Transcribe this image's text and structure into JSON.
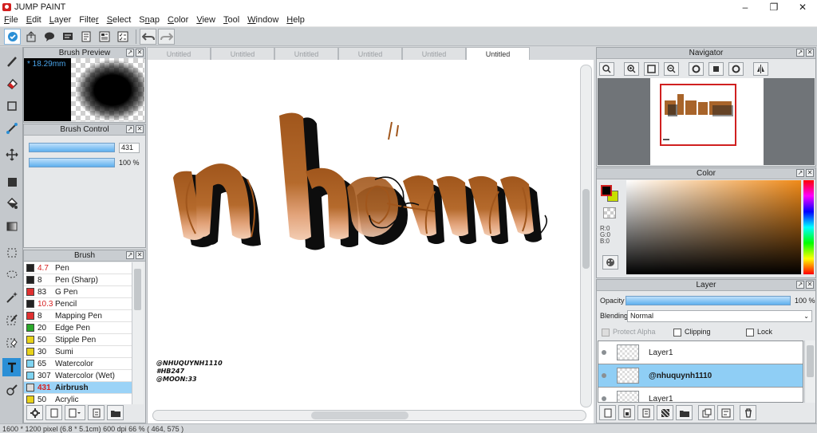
{
  "window": {
    "title": "JUMP PAINT",
    "minimize": "–",
    "maximize": "❐",
    "close": "✕"
  },
  "menu": [
    {
      "label": "File",
      "u": "F",
      "rest": "ile"
    },
    {
      "label": "Edit",
      "u": "E",
      "rest": "dit"
    },
    {
      "label": "Layer",
      "u": "L",
      "rest": "ayer"
    },
    {
      "label": "Filter",
      "pre": "Filte",
      "u": "r",
      "rest": ""
    },
    {
      "label": "Select",
      "u": "S",
      "rest": "elect"
    },
    {
      "label": "Snap",
      "pre": "S",
      "u": "n",
      "rest": "ap"
    },
    {
      "label": "Color",
      "u": "C",
      "rest": "olor"
    },
    {
      "label": "View",
      "u": "V",
      "rest": "iew"
    },
    {
      "label": "Tool",
      "u": "T",
      "rest": "ool"
    },
    {
      "label": "Window",
      "u": "W",
      "rest": "indow"
    },
    {
      "label": "Help",
      "u": "H",
      "rest": "elp"
    }
  ],
  "toolbar": {
    "icons": [
      "check-icon",
      "export-icon",
      "speech-bubble-icon",
      "comment-icon",
      "page-icon",
      "panel-icon",
      "checklist-icon"
    ],
    "undo_icon": "undo-icon",
    "redo_icon": "redo-icon"
  },
  "tools": [
    "brush-tool-icon",
    "eraser-tool-icon",
    "rectangle-tool-icon",
    "line-tool-icon",
    "move-tool-icon",
    "fill-rect-tool-icon",
    "bucket-tool-icon",
    "gradient-tool-icon",
    "rect-select-tool-icon",
    "lasso-tool-icon",
    "magic-wand-tool-icon",
    "select-pen-tool-icon",
    "select-eraser-tool-icon",
    "text-tool-icon",
    "eyedropper-tool-icon"
  ],
  "brush_preview": {
    "title": "Brush Preview",
    "size_label": "* 18.29mm"
  },
  "brush_control": {
    "title": "Brush Control",
    "size_value": "431",
    "opacity_value": "100 %"
  },
  "brush_panel": {
    "title": "Brush",
    "items": [
      {
        "size": "4.7",
        "name": "Pen",
        "color": "#222222",
        "red": true
      },
      {
        "size": "8",
        "name": "Pen (Sharp)",
        "color": "#222222",
        "red": false
      },
      {
        "size": "83",
        "name": "G Pen",
        "color": "#e03030",
        "red": false
      },
      {
        "size": "10.3",
        "name": "Pencil",
        "color": "#222222",
        "red": true
      },
      {
        "size": "8",
        "name": "Mapping Pen",
        "color": "#e03030",
        "red": false
      },
      {
        "size": "20",
        "name": "Edge Pen",
        "color": "#2aa82a",
        "red": false
      },
      {
        "size": "50",
        "name": "Stipple Pen",
        "color": "#e8d21a",
        "red": false
      },
      {
        "size": "30",
        "name": "Sumi",
        "color": "#e8d21a",
        "red": false
      },
      {
        "size": "65",
        "name": "Watercolor",
        "color": "#7fd4f2",
        "red": false
      },
      {
        "size": "307",
        "name": "Watercolor (Wet)",
        "color": "#7fd4f2",
        "red": false
      },
      {
        "size": "431",
        "name": "Airbrush",
        "color": "#dcdcdc",
        "red": true
      },
      {
        "size": "50",
        "name": "Acrylic",
        "color": "#e8d21a",
        "red": false
      }
    ]
  },
  "canvas": {
    "tabs": [
      "Untitled",
      "Untitled",
      "Untitled",
      "Untitled",
      "Untitled",
      "Untitled"
    ],
    "active_tab": 5,
    "artwork_text": "nhớm",
    "watermark": [
      "@NHUQUYNH1110",
      "#HB247",
      "@MOON:33"
    ]
  },
  "navigator": {
    "title": "Navigator"
  },
  "color_panel": {
    "title": "Color",
    "r": "R:0",
    "g": "G:0",
    "b": "B:0",
    "foreground": "#000000",
    "background": "#c8e000"
  },
  "layer_panel": {
    "title": "Layer",
    "opacity_label": "Opacity",
    "opacity_value": "100 %",
    "blending_label": "Blending",
    "blending_value": "Normal",
    "protect_alpha": "Protect Alpha",
    "clipping": "Clipping",
    "lock": "Lock",
    "layers": [
      {
        "name": "Layer1",
        "selected": false
      },
      {
        "name": "@nhuquynh1110",
        "selected": true
      },
      {
        "name": "Layer1",
        "selected": false
      }
    ]
  },
  "status": {
    "text": "1600 * 1200 pixel  (6.8 * 5.1cm)  600 dpi  66 %  ( 464, 575 )"
  }
}
